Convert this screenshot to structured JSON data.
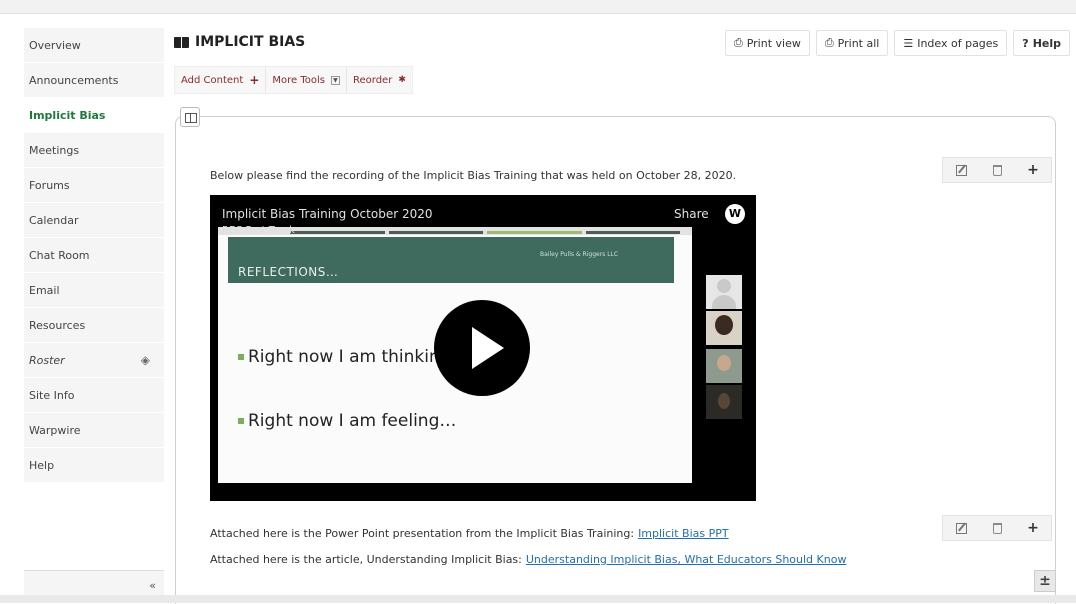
{
  "sidebar": {
    "items": [
      {
        "label": "Overview"
      },
      {
        "label": "Announcements"
      },
      {
        "label": "Implicit Bias"
      },
      {
        "label": "Meetings"
      },
      {
        "label": "Forums"
      },
      {
        "label": "Calendar"
      },
      {
        "label": "Chat Room"
      },
      {
        "label": "Email"
      },
      {
        "label": "Resources"
      },
      {
        "label": "Roster"
      },
      {
        "label": "Site Info"
      },
      {
        "label": "Warpwire"
      },
      {
        "label": "Help"
      }
    ],
    "active_item": "Implicit Bias",
    "collapse_glyph": "«"
  },
  "page": {
    "title": "IMPLICIT BIAS",
    "title_icon": "book-icon"
  },
  "header_buttons": {
    "print_view": "Print view",
    "print_all": "Print all",
    "index": "Index of pages",
    "help": "Help"
  },
  "toolbar": {
    "add_content": "Add Content",
    "more_tools": "More Tools",
    "reorder": "Reorder"
  },
  "content": {
    "intro_text": "Below please find the recording of the Implicit Bias Training that was held on October 28, 2020.",
    "video": {
      "title": "Implicit Bias Training October 2020",
      "share_label": "Share",
      "logo": "W",
      "slide_overlay": "REC Fast Track",
      "slide_heading": "REFLECTIONS…",
      "slide_company": "Bailey Pulls & Riggers LLC",
      "bullet_1": "Right now I am thinkin",
      "bullet_2": "Right now I am feeling…"
    },
    "attachment_1_text": "Attached here is the Power Point presentation from the Implicit Bias Training:",
    "attachment_1_link": "Implicit Bias PPT",
    "attachment_2_text": "Attached here is the article, Understanding Implicit Bias:",
    "attachment_2_link": "Understanding Implicit Bias, What Educators Should Know"
  },
  "colors": {
    "active_nav": "#1d7a3a",
    "tool_text": "#8a2b2b",
    "link": "#1f6fb2",
    "slide_header": "#3e6b5e"
  }
}
